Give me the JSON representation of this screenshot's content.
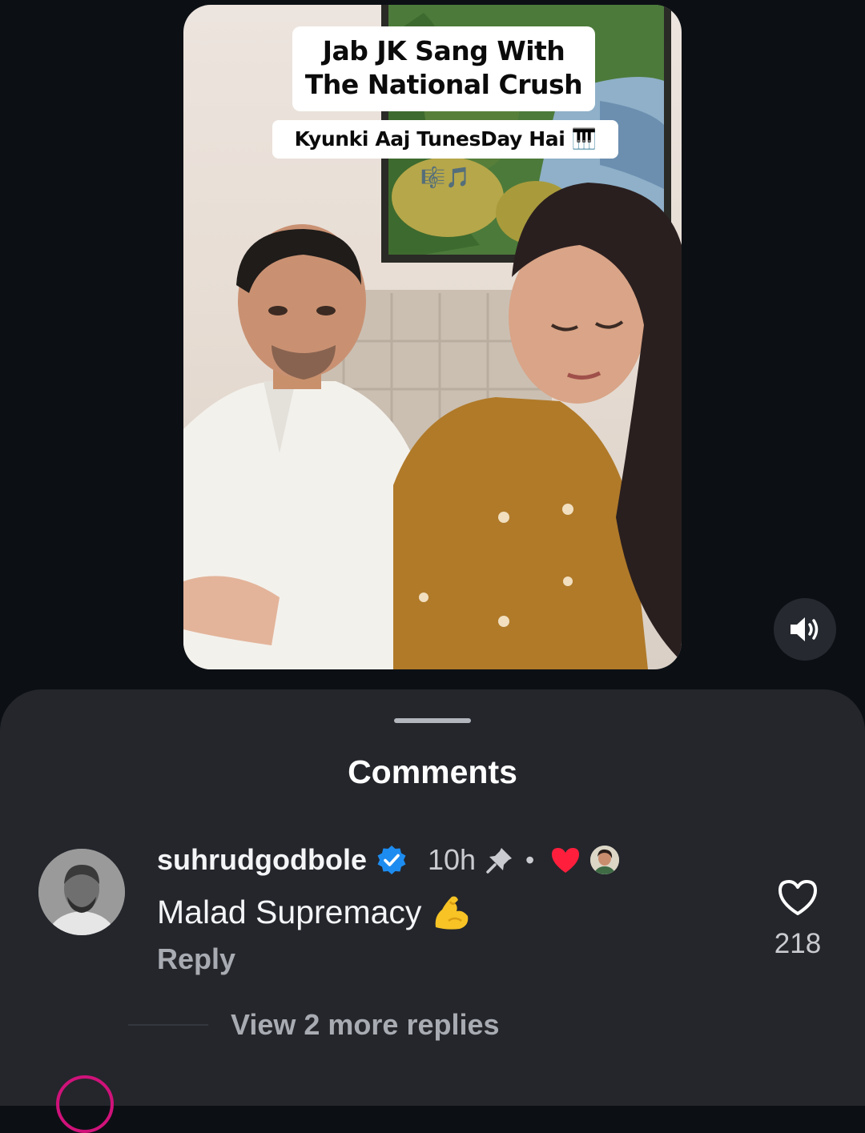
{
  "video": {
    "caption_title_line1": "Jab JK Sang With",
    "caption_title_line2": "The National Crush",
    "caption_subtitle": "Kyunki Aaj TunesDay Hai 🎹🎼🎵"
  },
  "controls": {
    "mute_icon": "speaker-icon"
  },
  "comments": {
    "title": "Comments",
    "items": [
      {
        "username": "suhrudgodbole",
        "verified": true,
        "time": "10h",
        "pinned": true,
        "liked_by_creator": true,
        "text": "Malad Supremacy",
        "emoji": "flexed-biceps",
        "reply_label": "Reply",
        "likes": "218",
        "view_replies_label": "View 2 more replies"
      }
    ]
  },
  "colors": {
    "background": "#0c1015",
    "sheet": "#24262c",
    "verified_blue": "#1d8cf0",
    "heart_red": "#ff1f3d",
    "secondary_text": "#a8abb1"
  }
}
